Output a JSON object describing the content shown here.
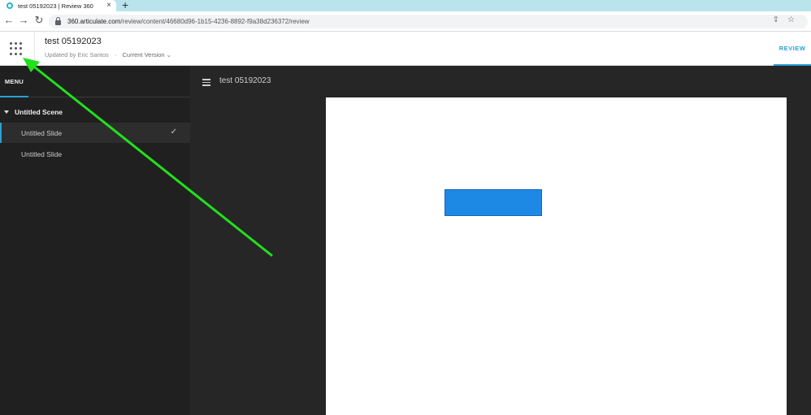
{
  "browser": {
    "tab_title": "test 05192023 | Review 360",
    "tab_close": "×",
    "new_tab": "+",
    "back": "←",
    "forward": "→",
    "reload": "↻",
    "url_host": "360.articulate.com",
    "url_path": "/review/content/46680d96-1b15-4236-8892-f9a38d236372/review",
    "omnibox_icons": "⇪☆"
  },
  "header": {
    "title": "test 05192023",
    "updated_by": "Updated by Eric Santos",
    "separator": "·",
    "version": "Current Version ⌄",
    "review_tab": "REVIEW"
  },
  "sidebar": {
    "menu_label": "MENU",
    "scene_label": "Untitled Scene",
    "slides": [
      {
        "label": "Untitled Slide",
        "active": true,
        "check": "✓"
      },
      {
        "label": "Untitled Slide",
        "active": false
      }
    ]
  },
  "stage": {
    "title": "test 05192023"
  },
  "colors": {
    "accent": "#2a9fd6",
    "shape_fill": "#1e88e5",
    "annotation_arrow": "#22e01b"
  }
}
